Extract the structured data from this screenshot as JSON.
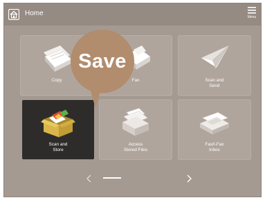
{
  "header": {
    "title": "Home",
    "home_icon": "home-icon",
    "menu_label": "Menu",
    "menu_icon": "hamburger-icon"
  },
  "tiles": [
    {
      "label_line1": "Copy",
      "label_line2": "",
      "icon": "copy-icon"
    },
    {
      "label_line1": "Fax",
      "label_line2": "",
      "icon": "fax-icon"
    },
    {
      "label_line1": "Scan and",
      "label_line2": "Send",
      "icon": "paper-plane-icon"
    },
    {
      "label_line1": "Scan and",
      "label_line2": "Store",
      "icon": "storage-box-icon",
      "selected": true
    },
    {
      "label_line1": "Access",
      "label_line2": "Stored Files",
      "icon": "file-tray-icon"
    },
    {
      "label_line1": "Fax/I-Fax",
      "label_line2": "Inbox",
      "icon": "inbox-tray-icon"
    }
  ],
  "callout": {
    "text": "Save"
  },
  "pager": {
    "current_page": 1,
    "prev_icon": "chevron-left-icon",
    "next_icon": "chevron-right-icon"
  },
  "colors": {
    "background": "#a49a92",
    "tile": "#b0a59d",
    "tile_selected": "#2e2c2b",
    "callout": "#b18c6d"
  }
}
